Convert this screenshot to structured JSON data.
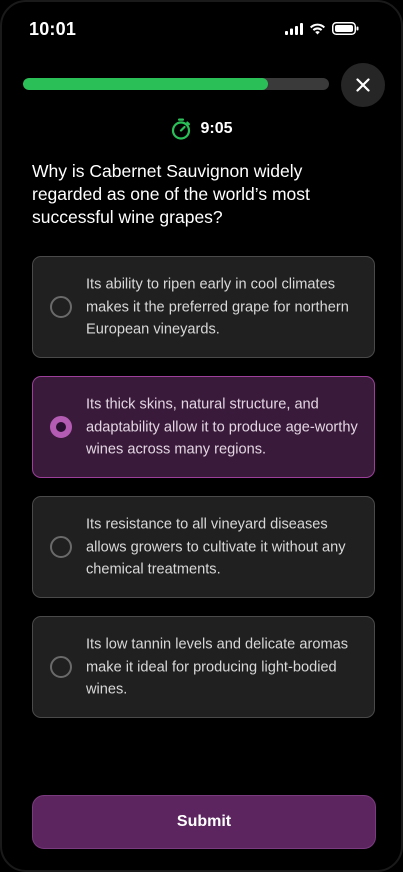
{
  "status_bar": {
    "time": "10:01",
    "icons": [
      "signal-icon",
      "wifi-icon",
      "battery-icon"
    ]
  },
  "progress": {
    "value": 0.8,
    "color": "#2bbf58"
  },
  "timer": {
    "icon": "stopwatch-icon",
    "text": "9:05",
    "icon_color": "#2bbf58"
  },
  "question": {
    "text": "Why is Cabernet Sauvignon widely regarded as one of the world’s most successful wine grapes?"
  },
  "options": [
    {
      "text": "Its ability to ripen early in cool climates makes it the preferred grape for northern European vineyards.",
      "selected": false
    },
    {
      "text": "Its thick skins, natural structure, and adaptability allow it to produce age-worthy wines across many regions.",
      "selected": true
    },
    {
      "text": "Its resistance to all vineyard diseases allows growers to cultivate it without any chemical treatments.",
      "selected": false
    },
    {
      "text": "Its low tannin levels and delicate aromas make it ideal for producing light-bodied wines.",
      "selected": false
    }
  ],
  "submit": {
    "label": "Submit"
  },
  "colors": {
    "accent": "#b45cb4",
    "submit_bg": "#5c2560",
    "selected_border": "#9b3f9b"
  }
}
